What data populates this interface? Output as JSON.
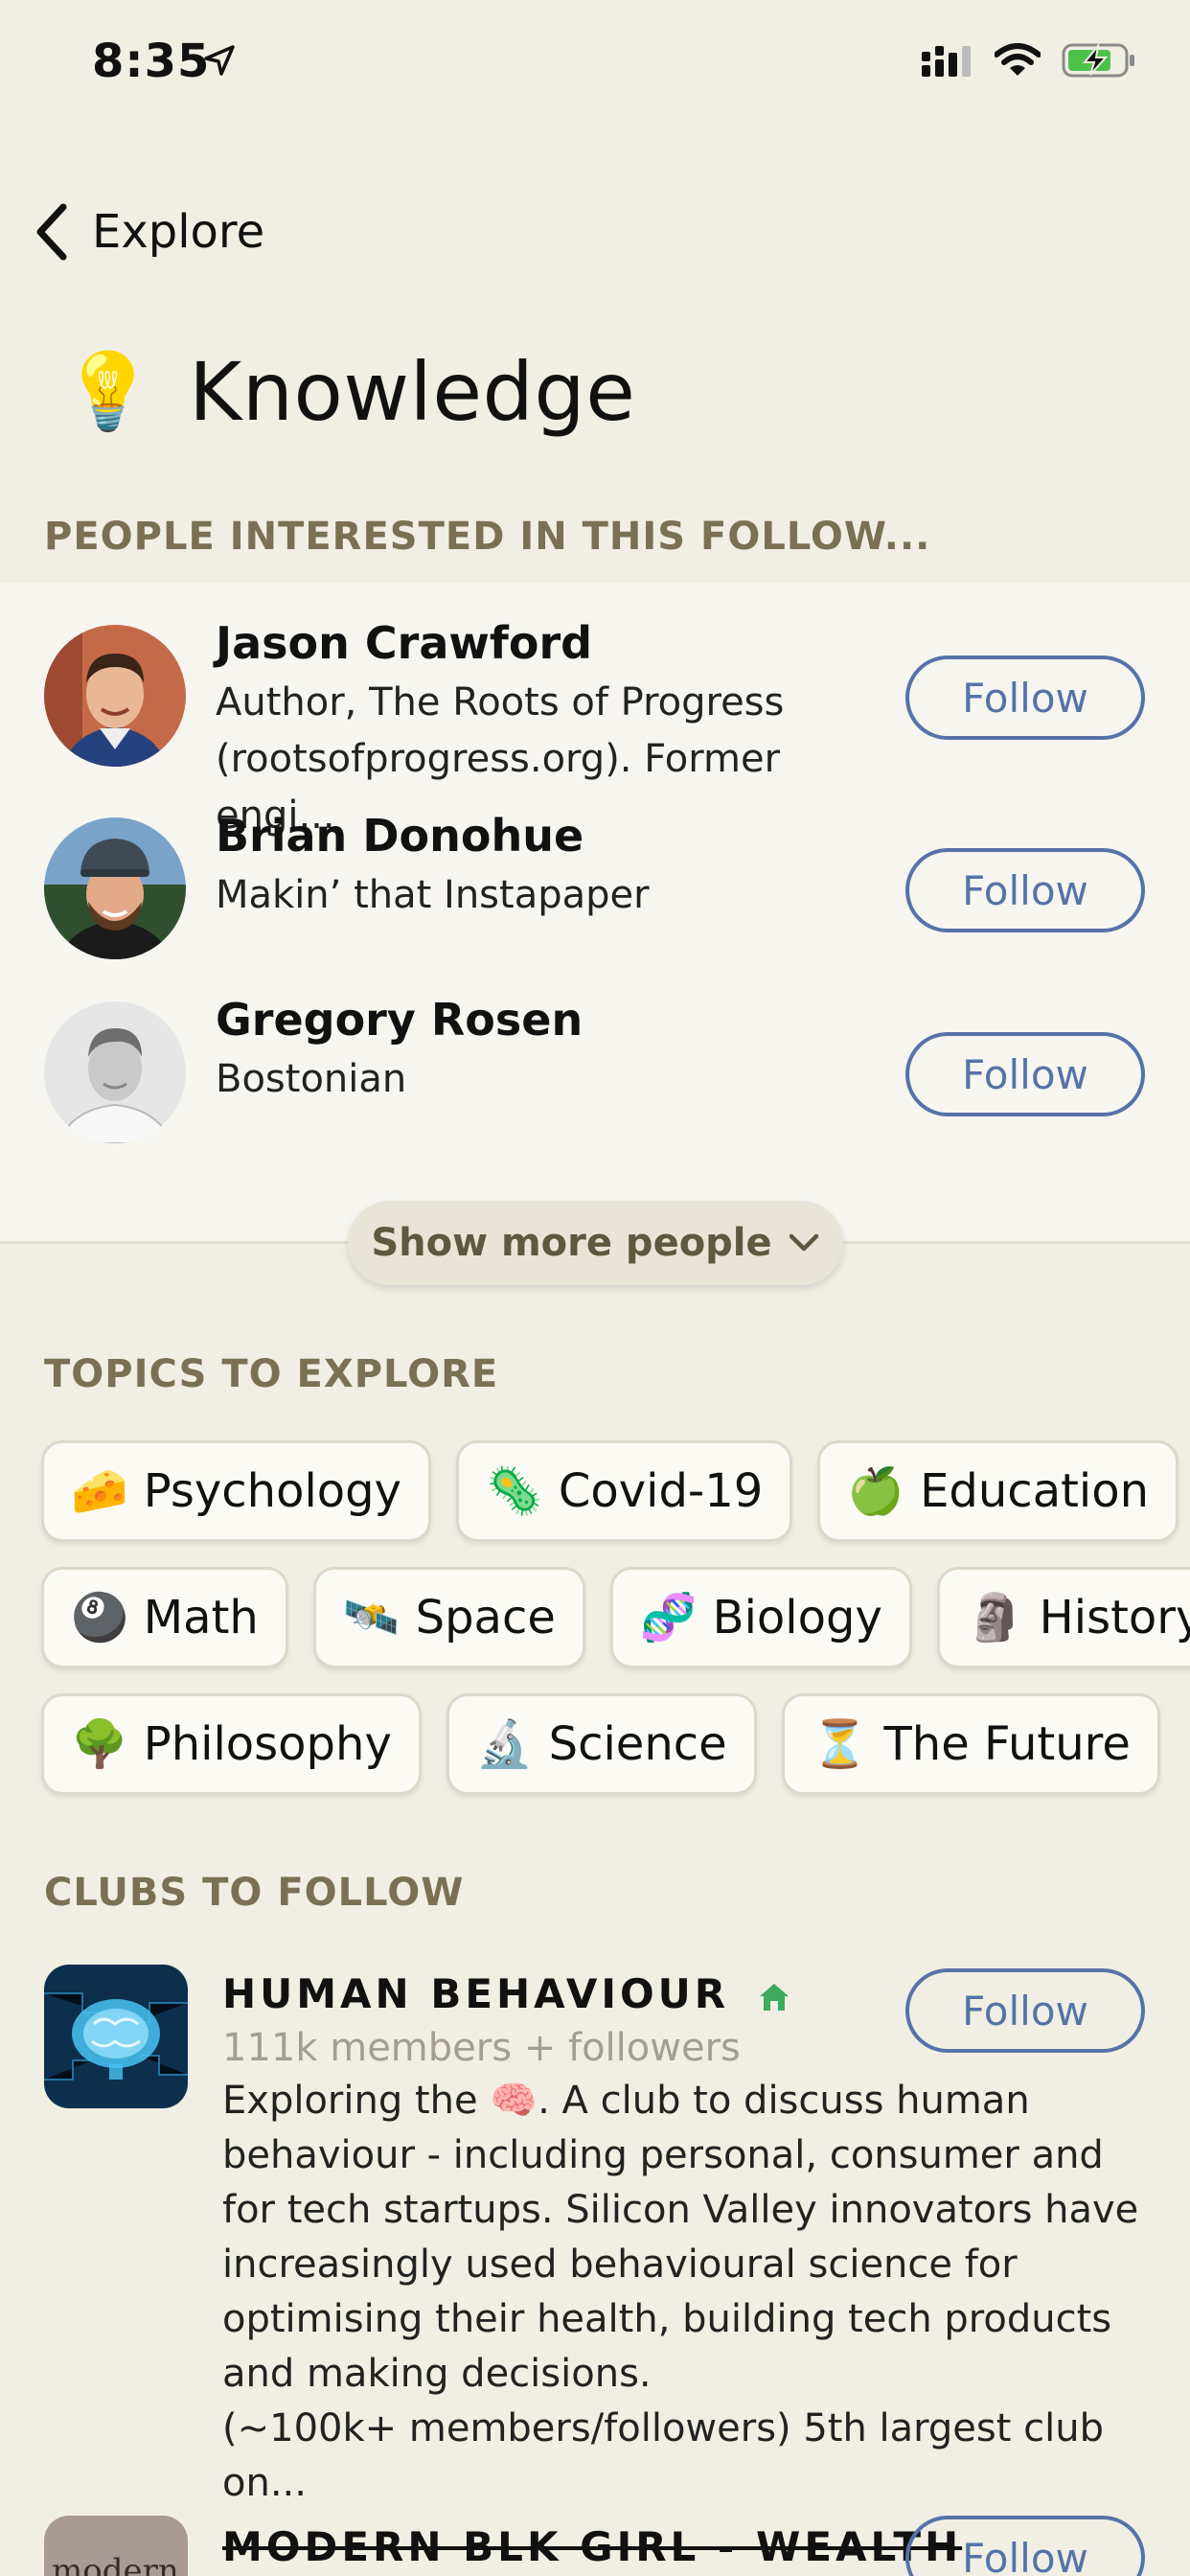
{
  "status": {
    "time": "8:35"
  },
  "nav": {
    "back_label": "Explore"
  },
  "heading": {
    "emoji": "💡",
    "title": "Knowledge"
  },
  "people_section": {
    "title": "PEOPLE INTERESTED IN THIS FOLLOW...",
    "people": [
      {
        "name": "Jason Crawford",
        "bio": "Author, The Roots of Progress (rootsofprogress.org). Former engi...",
        "follow_label": "Follow"
      },
      {
        "name": "Brian Donohue",
        "bio": "Makin’ that Instapaper",
        "follow_label": "Follow"
      },
      {
        "name": "Gregory Rosen",
        "bio": "Bostonian",
        "follow_label": "Follow"
      }
    ],
    "show_more_label": "Show more people"
  },
  "topics_section": {
    "title": "TOPICS TO EXPLORE",
    "rows": [
      [
        {
          "emoji": "🧀",
          "label": "Psychology"
        },
        {
          "emoji": "🦠",
          "label": "Covid-19"
        },
        {
          "emoji": "🍏",
          "label": "Education"
        }
      ],
      [
        {
          "emoji": "🎱",
          "label": "Math"
        },
        {
          "emoji": "🛰️",
          "label": "Space"
        },
        {
          "emoji": "🧬",
          "label": "Biology"
        },
        {
          "emoji": "🗿",
          "label": "History"
        }
      ],
      [
        {
          "emoji": "🌳",
          "label": "Philosophy"
        },
        {
          "emoji": "🔬",
          "label": "Science"
        },
        {
          "emoji": "⏳",
          "label": "The Future"
        }
      ]
    ]
  },
  "clubs_section": {
    "title": "CLUBS TO FOLLOW",
    "clubs": [
      {
        "name": "HUMAN BEHAVIOUR",
        "members": "111k members + followers",
        "desc_before": "Exploring the ",
        "desc_emoji": "🧠",
        "desc_after": ". A club to discuss human behaviour -  including personal, consumer and for tech startups. Silicon Valley innovators have increasingly used behavioural science for optimising their health, building tech products and making decisions.",
        "desc_more": "(~100k+ members/followers) 5th largest club on...",
        "follow_label": "Follow"
      },
      {
        "name": "MODERN BLK GIRL - WEALTH",
        "logo_text": "modern",
        "follow_label": "Follow"
      }
    ]
  },
  "colors": {
    "accent": "#5573a8",
    "section_title": "#7a7154",
    "background": "#f1efe4"
  }
}
